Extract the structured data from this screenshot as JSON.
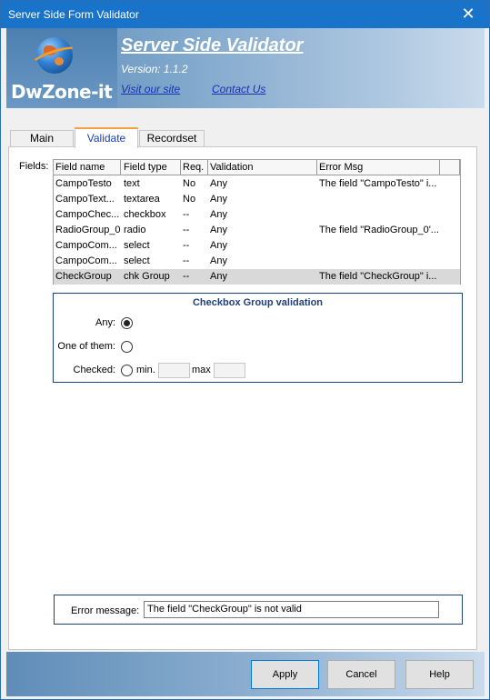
{
  "window": {
    "title": "Server Side Form Validator",
    "close_glyph": "✕"
  },
  "banner": {
    "logo_text": "DwZone-it",
    "app_title": "Server Side Validator",
    "version": "Version: 1.1.2",
    "links": {
      "visit": "Visit our site",
      "contact": "Contact Us"
    }
  },
  "tabs": [
    {
      "label": "Main",
      "active": false
    },
    {
      "label": "Validate",
      "active": true
    },
    {
      "label": "Recordset",
      "active": false
    }
  ],
  "fields": {
    "label": "Fields:",
    "columns": [
      "Field name",
      "Field type",
      "Req.",
      "Validation",
      "Error Msg"
    ],
    "rows": [
      [
        "CampoTesto",
        "text",
        "No",
        "Any",
        "The field \"CampoTesto\" i..."
      ],
      [
        "CampoText...",
        "textarea",
        "No",
        "Any",
        ""
      ],
      [
        "CampoChec...",
        "checkbox",
        "--",
        "Any",
        ""
      ],
      [
        "RadioGroup_0",
        "radio",
        "--",
        "Any",
        "The field \"RadioGroup_0'..."
      ],
      [
        "CampoCom...",
        "select",
        "--",
        "Any",
        ""
      ],
      [
        "CampoCom...",
        "select",
        "--",
        "Any",
        ""
      ],
      [
        "CheckGroup",
        "chk Group",
        "--",
        "Any",
        "The field \"CheckGroup\" i..."
      ]
    ],
    "selected_row": 6
  },
  "checkbox_group": {
    "title": "Checkbox Group validation",
    "options": {
      "any": "Any:",
      "one_of": "One of them:",
      "checked": "Checked:"
    },
    "min_label": "min.",
    "max_label": "max",
    "selected_option": "any"
  },
  "error_message": {
    "label": "Error message:",
    "value": "The field \"CheckGroup\" is not valid"
  },
  "buttons": {
    "apply": "Apply",
    "cancel": "Cancel",
    "help": "Help"
  },
  "colors": {
    "titlebar": "#1873c9",
    "group_border": "#1e3f7e",
    "link": "#1a2fb5",
    "tab_accent": "#f3a346"
  }
}
